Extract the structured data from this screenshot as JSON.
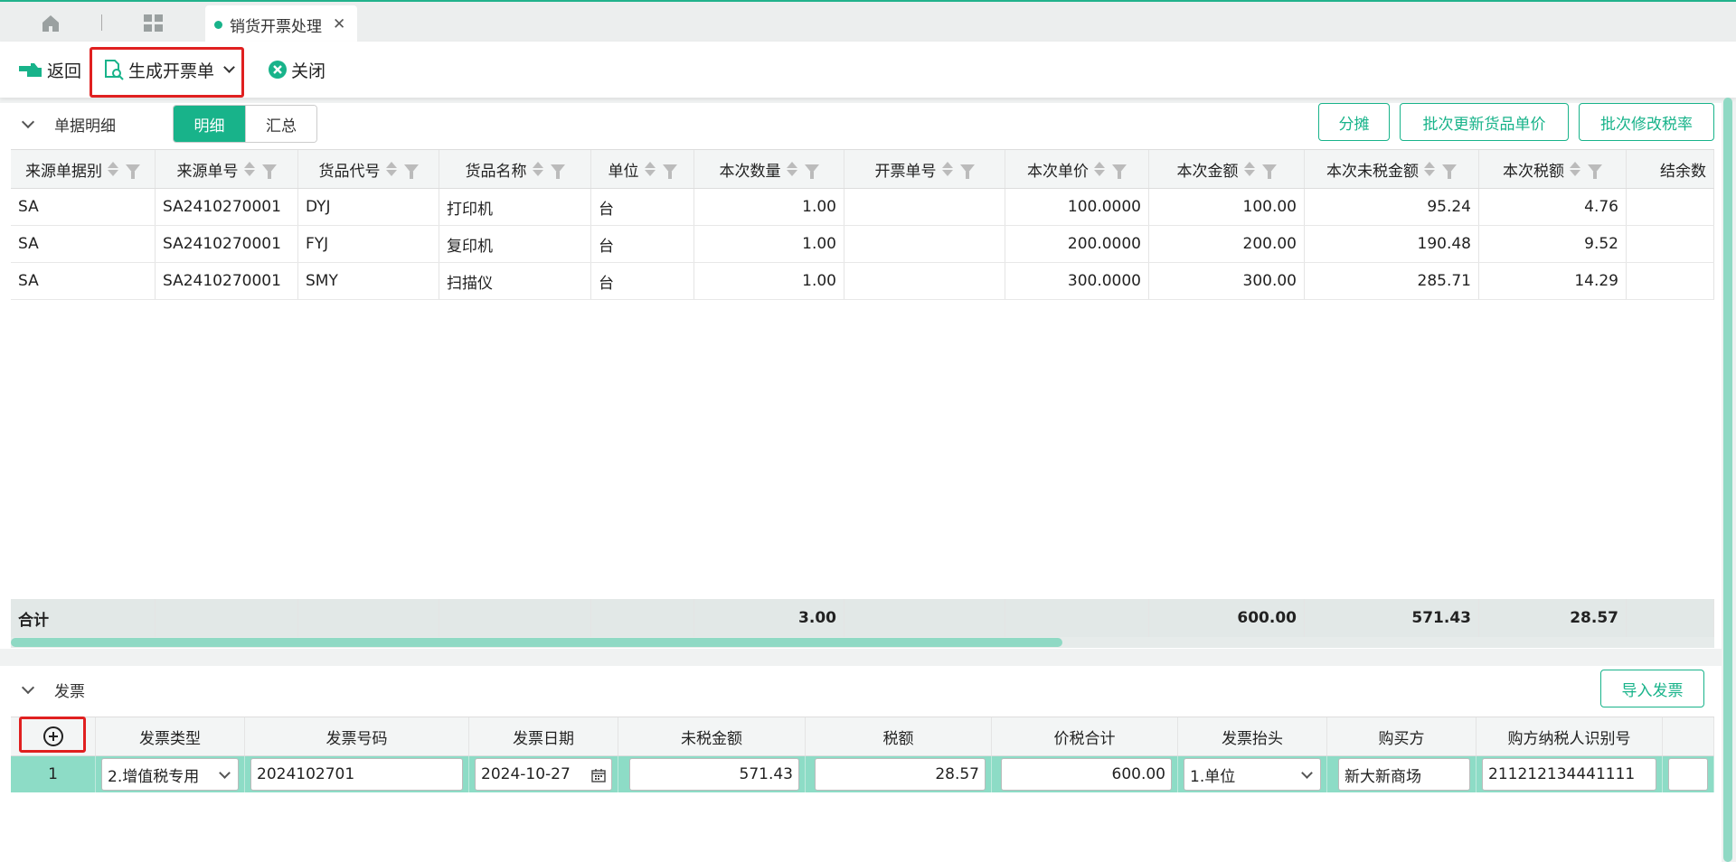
{
  "tabs": {
    "home_icon": "home-icon",
    "apps_icon": "grid-icon",
    "active_tab": "销货开票处理",
    "accent_color": "#18b38a"
  },
  "toolbar": {
    "back_label": "返回",
    "generate_label": "生成开票单",
    "close_label": "关闭"
  },
  "detail": {
    "section_title": "单据明细",
    "view_toggle": {
      "detail": "明细",
      "summary": "汇总"
    },
    "buttons": {
      "allocate": "分摊",
      "batch_price": "批次更新货品单价",
      "batch_tax": "批次修改税率"
    },
    "columns": [
      "来源单据别",
      "来源单号",
      "货品代号",
      "货品名称",
      "单位",
      "本次数量",
      "开票单号",
      "本次单价",
      "本次金额",
      "本次未税金额",
      "本次税额",
      "结余数"
    ],
    "rows": [
      [
        "SA",
        "SA2410270001",
        "DYJ",
        "打印机",
        "台",
        "1.00",
        "",
        "100.0000",
        "100.00",
        "95.24",
        "4.76",
        ""
      ],
      [
        "SA",
        "SA2410270001",
        "FYJ",
        "复印机",
        "台",
        "1.00",
        "",
        "200.0000",
        "200.00",
        "190.48",
        "9.52",
        ""
      ],
      [
        "SA",
        "SA2410270001",
        "SMY",
        "扫描仪",
        "台",
        "1.00",
        "",
        "300.0000",
        "300.00",
        "285.71",
        "14.29",
        ""
      ]
    ],
    "total_label": "合计",
    "totals": {
      "qty": "3.00",
      "amount": "600.00",
      "untaxed": "571.43",
      "tax": "28.57"
    }
  },
  "invoice": {
    "section_title": "发票",
    "import_button": "导入发票",
    "add_icon": "plus-circle-icon",
    "columns": [
      "发票类型",
      "发票号码",
      "发票日期",
      "未税金额",
      "税额",
      "价税合计",
      "发票抬头",
      "购买方",
      "购方纳税人识别号"
    ],
    "row": {
      "index": "1",
      "type": "2.增值税专用",
      "number": "2024102701",
      "date": "2024-10-27",
      "untaxed": "571.43",
      "tax": "28.57",
      "total": "600.00",
      "title": "1.单位",
      "buyer": "新大新商场",
      "taxpayer_id": "211212134441111"
    }
  }
}
